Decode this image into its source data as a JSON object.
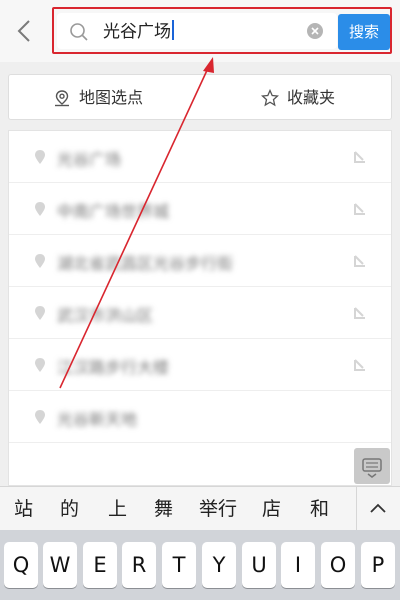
{
  "search": {
    "query": "光谷广场",
    "button_label": "搜索"
  },
  "tabs": {
    "map_pick_label": "地图选点",
    "favorites_label": "收藏夹"
  },
  "results": [
    "光谷广场",
    "中南广场世界城",
    "湖北省武昌区光谷步行街",
    "武汉市洪山区",
    "江汉路步行大楼",
    "光谷新天地"
  ],
  "candidates": [
    "站",
    "的",
    "上",
    "舞",
    "举行",
    "店",
    "和"
  ],
  "keyboard": {
    "row1": [
      "Q",
      "W",
      "E",
      "R",
      "T",
      "Y",
      "U",
      "I",
      "O",
      "P"
    ]
  },
  "colors": {
    "annotation_red": "#d9262f",
    "search_button_blue": "#2b8de8"
  }
}
